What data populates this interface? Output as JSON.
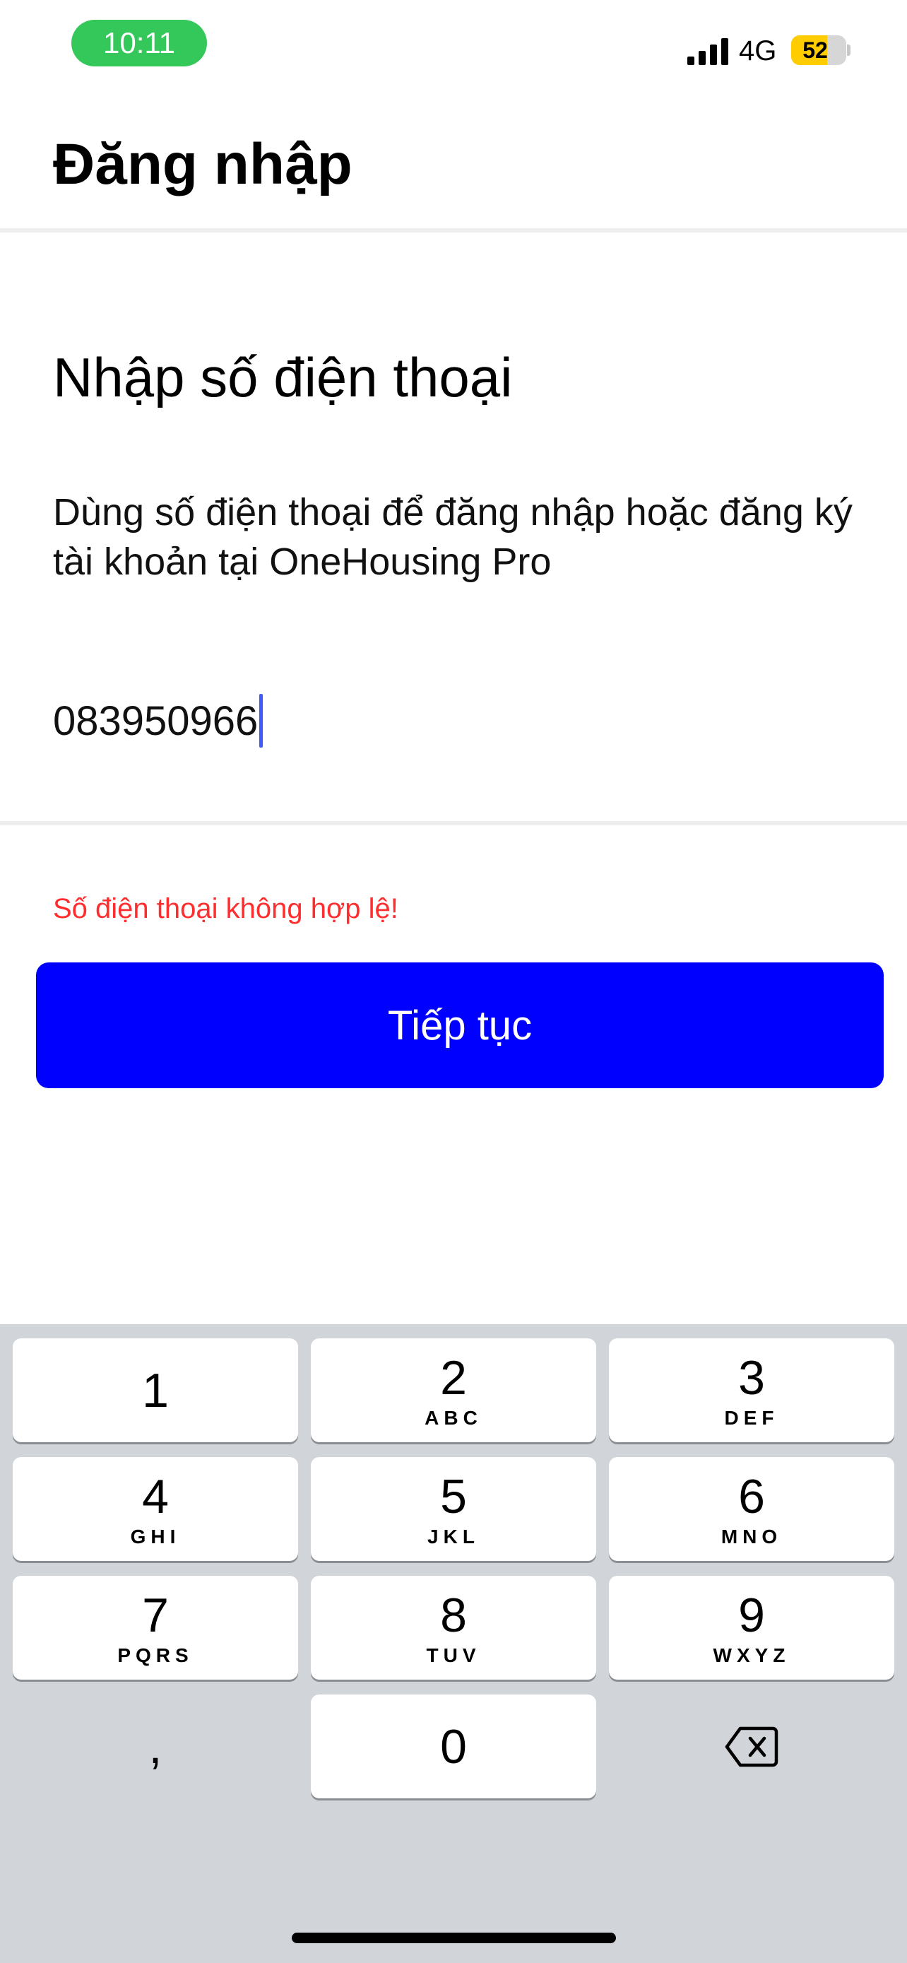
{
  "status_bar": {
    "time": "10:11",
    "network": "4G",
    "battery": "52",
    "battery_level": 0.52,
    "time_pill_color": "#34c759",
    "battery_color": "#ffcc00"
  },
  "header": {
    "title": "Đăng nhập"
  },
  "form": {
    "heading": "Nhập số điện thoại",
    "description": "Dùng số điện thoại để đăng nhập hoặc đăng ký tài khoản tại OneHousing Pro",
    "phone_value": "083950966",
    "error": "Số điện thoại không hợp lệ!",
    "error_color": "#ff2d2d",
    "continue_label": "Tiếp tục",
    "button_color": "#0000ff"
  },
  "keyboard": {
    "keys": [
      {
        "digit": "1",
        "letters": ""
      },
      {
        "digit": "2",
        "letters": "ABC"
      },
      {
        "digit": "3",
        "letters": "DEF"
      },
      {
        "digit": "4",
        "letters": "GHI"
      },
      {
        "digit": "5",
        "letters": "JKL"
      },
      {
        "digit": "6",
        "letters": "MNO"
      },
      {
        "digit": "7",
        "letters": "PQRS"
      },
      {
        "digit": "8",
        "letters": "TUV"
      },
      {
        "digit": "9",
        "letters": "WXYZ"
      },
      {
        "digit": "0",
        "letters": ""
      }
    ],
    "comma": ",",
    "delete_icon": "backspace-icon"
  }
}
